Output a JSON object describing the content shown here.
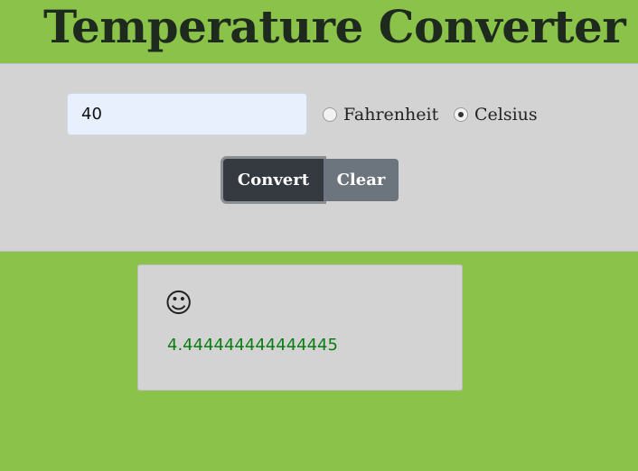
{
  "header": {
    "title": "Temperature Converter"
  },
  "form": {
    "input_value": "40",
    "radios": [
      {
        "label": "Fahrenheit",
        "checked": false
      },
      {
        "label": "Celsius",
        "checked": true
      }
    ],
    "buttons": {
      "convert_label": "Convert",
      "clear_label": "Clear"
    }
  },
  "result": {
    "icon": "smiley-face-icon",
    "icon_glyph": "☺",
    "value": "4.444444444444445"
  },
  "colors": {
    "page_background": "#8bc34a",
    "panel_background": "#d3d3d3",
    "result_text": "#0a7d12",
    "convert_button": "#343a40",
    "clear_button": "#6c757d"
  }
}
